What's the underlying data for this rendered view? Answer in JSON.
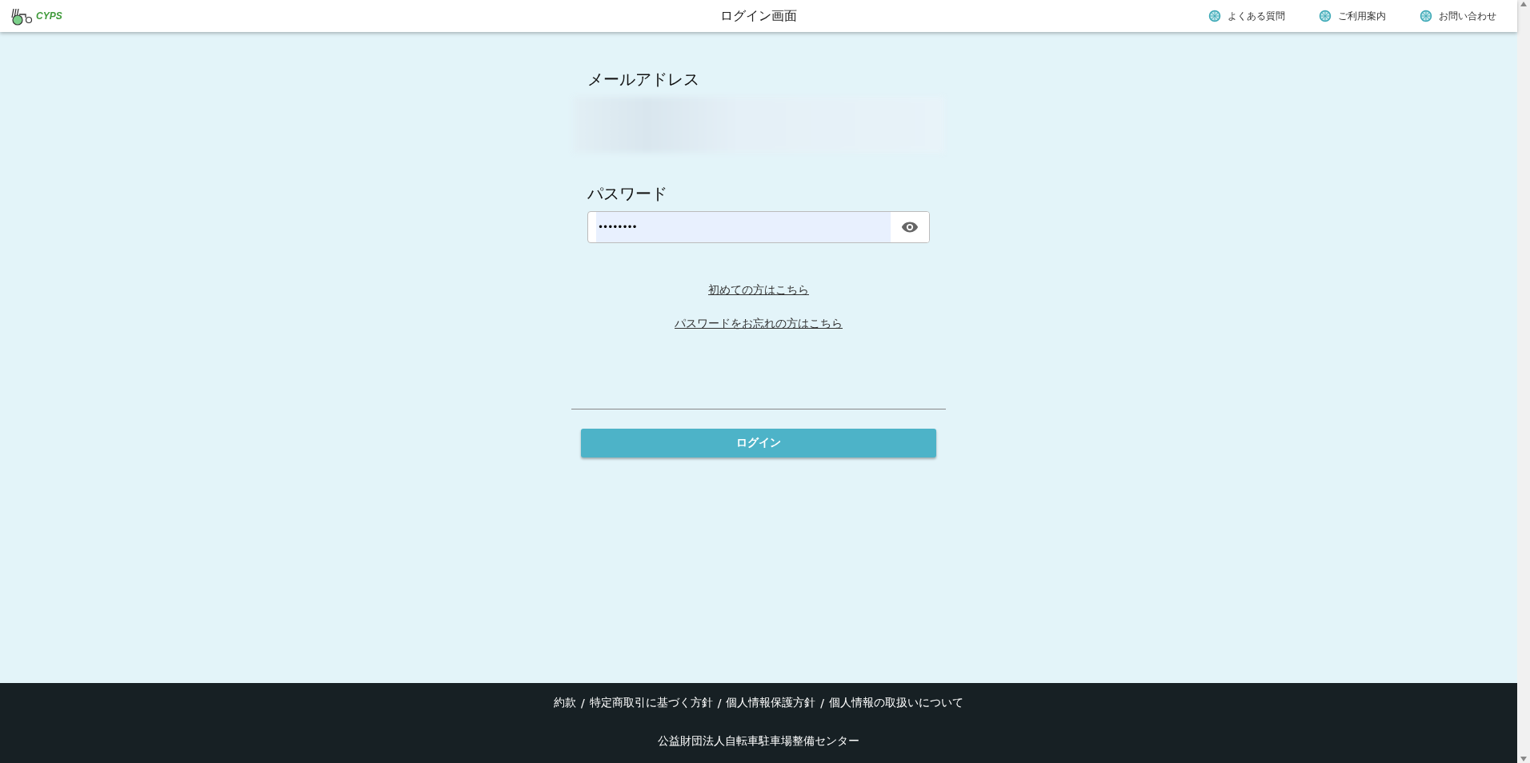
{
  "header": {
    "logo": "CYPS",
    "title": "ログイン画面",
    "nav": [
      {
        "label": "よくある質問"
      },
      {
        "label": "ご利用案内"
      },
      {
        "label": "お問い合わせ"
      }
    ]
  },
  "form": {
    "email": {
      "label": "メールアドレス",
      "blurred": true
    },
    "password": {
      "label": "パスワード",
      "value": "••••••••"
    },
    "links": [
      "初めての方はこちら",
      "パスワードをお忘れの方はこちら"
    ],
    "submit": "ログイン"
  },
  "footer": {
    "links": [
      "約款",
      "特定商取引に基づく方針",
      "個人情報保護方針",
      "個人情報の取扱いについて"
    ],
    "separator": "/",
    "organization": "公益財団法人自転車駐車場整備センター"
  }
}
